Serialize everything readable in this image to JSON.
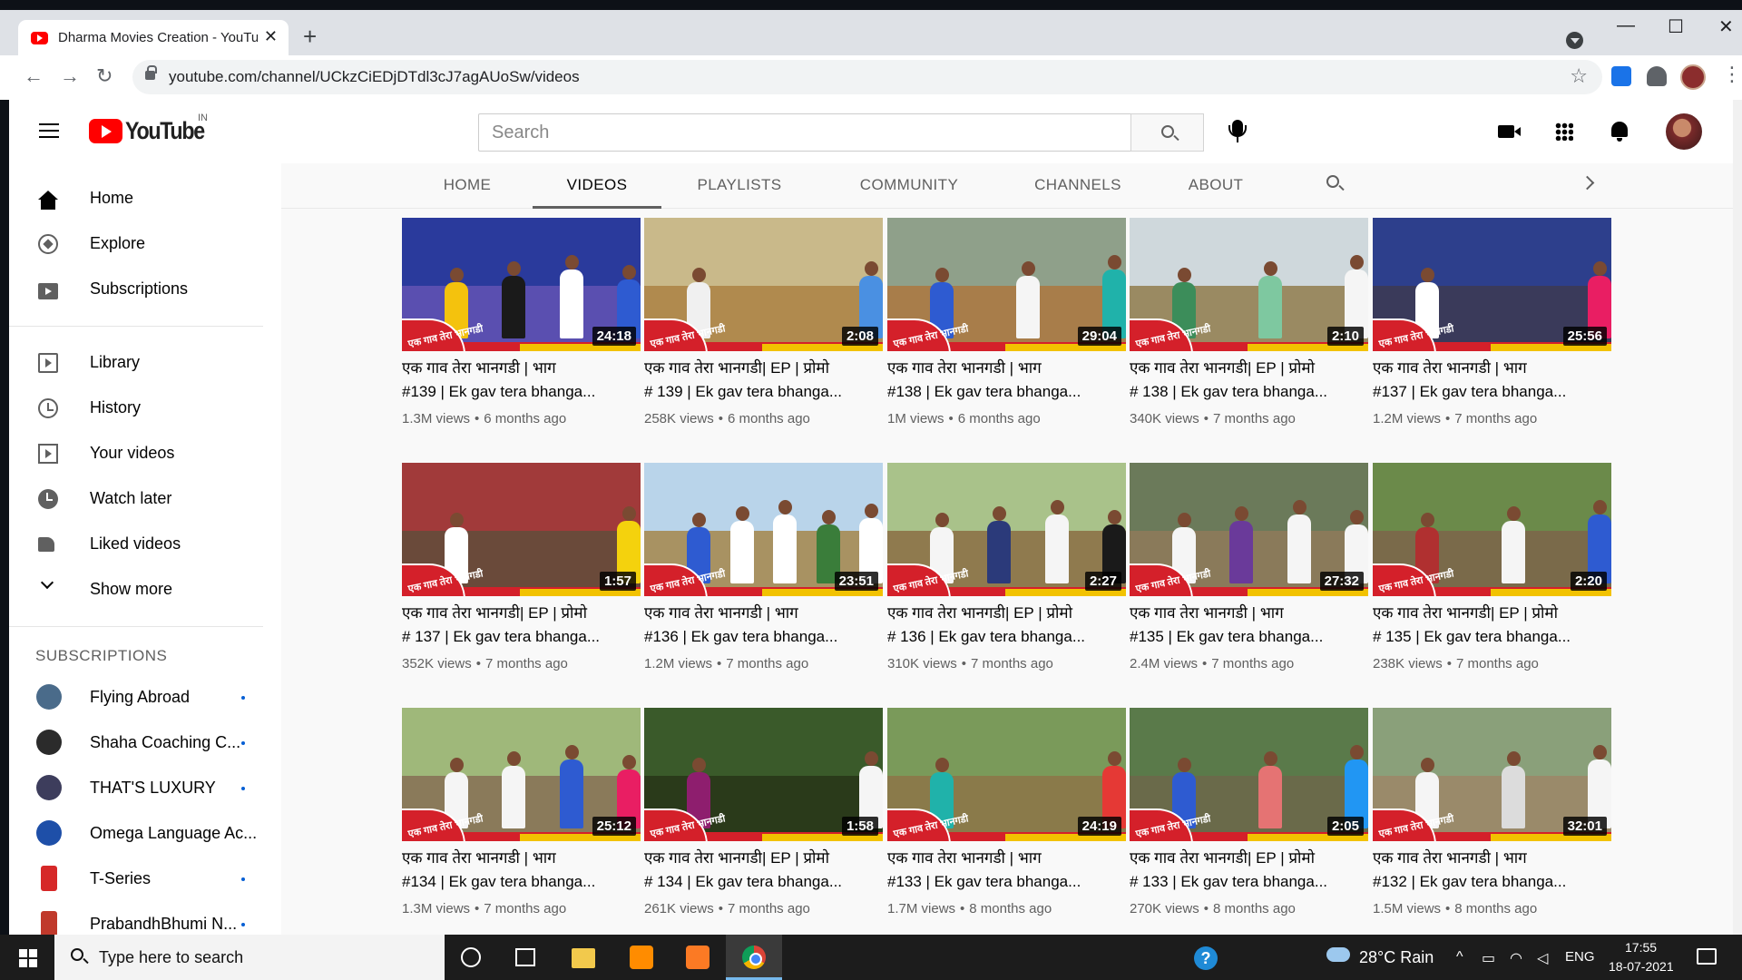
{
  "browser": {
    "tab_title": "Dharma Movies Creation - YouTube",
    "url": "youtube.com/channel/UCkzCiEDjDTdl3cJ7agAUoSw/videos",
    "new_tab_label": "+",
    "close_label": "✕"
  },
  "masthead": {
    "logo_text": "YouTube",
    "country": "IN",
    "search_placeholder": "Search"
  },
  "sidebar": {
    "main": [
      {
        "label": "Home",
        "icon": "home-icon"
      },
      {
        "label": "Explore",
        "icon": "explore-icon"
      },
      {
        "label": "Subscriptions",
        "icon": "subscriptions-icon"
      }
    ],
    "library": [
      {
        "label": "Library",
        "icon": "library-icon"
      },
      {
        "label": "History",
        "icon": "history-icon"
      },
      {
        "label": "Your videos",
        "icon": "your-videos-icon"
      },
      {
        "label": "Watch later",
        "icon": "watch-later-icon"
      },
      {
        "label": "Liked videos",
        "icon": "liked-videos-icon"
      },
      {
        "label": "Show more",
        "icon": "chevron-down-icon"
      }
    ],
    "subscriptions_heading": "SUBSCRIPTIONS",
    "subscriptions": [
      {
        "label": "Flying Abroad",
        "color": "#4a6b8a"
      },
      {
        "label": "Shaha Coaching C...",
        "color": "#2b2b2b"
      },
      {
        "label": "THAT'S LUXURY",
        "color": "#3d3d5c"
      },
      {
        "label": "Omega Language Ac...",
        "color": "#1e4fa8"
      },
      {
        "label": "T-Series",
        "color": "#d62828"
      },
      {
        "label": "PrabandhBhumi N...",
        "color": "#c0392b"
      }
    ]
  },
  "channel_tabs": [
    "HOME",
    "VIDEOS",
    "PLAYLISTS",
    "COMMUNITY",
    "CHANNELS",
    "ABOUT"
  ],
  "active_tab": "VIDEOS",
  "badge_text": "एक गाव तेरा भानगडी",
  "videos": [
    {
      "line1": "एक गाव तेरा भानगडी | भाग",
      "line2": "#139 | Ek gav tera bhanga...",
      "views": "1.3M views",
      "age": "6 months ago",
      "duration": "24:18",
      "sky": "#2a3a9c",
      "ground": "#5a4fb0",
      "figs": [
        "#f4c20d",
        "#1a1a1a",
        "#ffffff",
        "#2e5bd1"
      ]
    },
    {
      "line1": "एक गाव तेरा भानगडी| EP | प्रोमो",
      "line2": "# 139 | Ek gav tera bhanga...",
      "views": "258K views",
      "age": "6 months ago",
      "duration": "2:08",
      "sky": "#c9b98a",
      "ground": "#b08a4e",
      "figs": [
        "#f0f0f0",
        "#4a90e2"
      ]
    },
    {
      "line1": "एक गाव तेरा भानगडी | भाग",
      "line2": "#138 | Ek gav tera bhanga...",
      "views": "1M views",
      "age": "6 months ago",
      "duration": "29:04",
      "sky": "#8fa08a",
      "ground": "#a87d4a",
      "figs": [
        "#2e5bd1",
        "#f5f5f5",
        "#20b2aa"
      ]
    },
    {
      "line1": "एक गाव तेरा भानगडी| EP | प्रोमो",
      "line2": "# 138 | Ek gav tera bhanga...",
      "views": "340K views",
      "age": "7 months ago",
      "duration": "2:10",
      "sky": "#cfd8dc",
      "ground": "#9a8a62",
      "figs": [
        "#3c8d5a",
        "#7ec8a0",
        "#f5f5f5"
      ]
    },
    {
      "line1": "एक गाव तेरा भानगडी | भाग",
      "line2": "#137 | Ek gav tera bhanga...",
      "views": "1.2M views",
      "age": "7 months ago",
      "duration": "25:56",
      "sky": "#2d3f8c",
      "ground": "#3a3a5a",
      "figs": [
        "#ffffff",
        "#e91e63"
      ]
    },
    {
      "line1": "एक गाव तेरा भानगडी| EP | प्रोमो",
      "line2": "# 137 | Ek gav tera bhanga...",
      "views": "352K views",
      "age": "7 months ago",
      "duration": "1:57",
      "sky": "#a13a3a",
      "ground": "#6a4a3a",
      "figs": [
        "#ffffff",
        "#f4d20d"
      ]
    },
    {
      "line1": "एक गाव तेरा भानगडी | भाग",
      "line2": "#136 | Ek gav tera bhanga...",
      "views": "1.2M views",
      "age": "7 months ago",
      "duration": "23:51",
      "sky": "#b9d4ea",
      "ground": "#a89262",
      "figs": [
        "#2e5bd1",
        "#ffffff",
        "#ffffff",
        "#3a7d3a",
        "#ffffff"
      ]
    },
    {
      "line1": "एक गाव तेरा भानगडी| EP | प्रोमो",
      "line2": "# 136 | Ek gav tera bhanga...",
      "views": "310K views",
      "age": "7 months ago",
      "duration": "2:27",
      "sky": "#a9c28a",
      "ground": "#8f7a4e",
      "figs": [
        "#f5f5f5",
        "#2b3a7a",
        "#f5f5f5",
        "#1a1a1a"
      ]
    },
    {
      "line1": "एक गाव तेरा भानगडी | भाग",
      "line2": "#135 | Ek gav tera bhanga...",
      "views": "2.4M views",
      "age": "7 months ago",
      "duration": "27:32",
      "sky": "#6b7a5a",
      "ground": "#8a7a5a",
      "figs": [
        "#f5f5f5",
        "#6a3a9a",
        "#f5f5f5",
        "#f5f5f5"
      ]
    },
    {
      "line1": "एक गाव तेरा भानगडी| EP | प्रोमो",
      "line2": "# 135 | Ek gav tera bhanga...",
      "views": "238K views",
      "age": "7 months ago",
      "duration": "2:20",
      "sky": "#6b8a4a",
      "ground": "#7a6a4a",
      "figs": [
        "#b03030",
        "#f5f5f5",
        "#2e5bd1"
      ]
    },
    {
      "line1": "एक गाव तेरा भानगडी | भाग",
      "line2": "#134 | Ek gav tera bhanga...",
      "views": "1.3M views",
      "age": "7 months ago",
      "duration": "25:12",
      "sky": "#9fb87a",
      "ground": "#8a7a5a",
      "figs": [
        "#f5f5f5",
        "#f5f5f5",
        "#2e5bd1",
        "#e91e63"
      ]
    },
    {
      "line1": "एक गाव तेरा भानगडी| EP | प्रोमो",
      "line2": "# 134 | Ek gav tera bhanga...",
      "views": "261K views",
      "age": "7 months ago",
      "duration": "1:58",
      "sky": "#3a5a2a",
      "ground": "#2a3a1a",
      "figs": [
        "#8e1e6e",
        "#f5f5f5"
      ]
    },
    {
      "line1": "एक गाव तेरा भानगडी | भाग",
      "line2": "#133 | Ek gav tera bhanga...",
      "views": "1.7M views",
      "age": "8 months ago",
      "duration": "24:19",
      "sky": "#7a9a5a",
      "ground": "#8a7a4a",
      "figs": [
        "#20b2aa",
        "#e53935"
      ]
    },
    {
      "line1": "एक गाव तेरा भानगडी| EP | प्रोमो",
      "line2": "# 133 | Ek gav tera bhanga...",
      "views": "270K views",
      "age": "8 months ago",
      "duration": "2:05",
      "sky": "#5a7a4a",
      "ground": "#6a6a4a",
      "figs": [
        "#2e5bd1",
        "#e57373",
        "#2196f3"
      ]
    },
    {
      "line1": "एक गाव तेरा भानगडी | भाग",
      "line2": "#132 | Ek gav tera bhanga...",
      "views": "1.5M views",
      "age": "8 months ago",
      "duration": "32:01",
      "sky": "#8aa07a",
      "ground": "#9a8a6a",
      "figs": [
        "#f5f5f5",
        "#dcdcdc",
        "#f5f5f5"
      ]
    }
  ],
  "taskbar": {
    "search_text": "Type here to search",
    "weather": "28°C  Rain",
    "language": "ENG",
    "time": "17:55",
    "date": "18-07-2021"
  }
}
